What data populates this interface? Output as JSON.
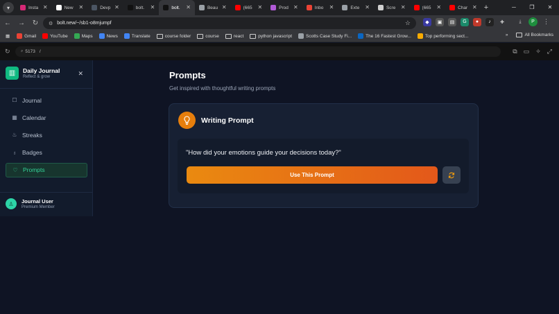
{
  "browser": {
    "tabs": [
      {
        "title": "Insta",
        "icon": "instagram-icon",
        "color": "#d62976",
        "active": false
      },
      {
        "title": "New",
        "icon": "new-tab-icon",
        "color": "#ffffff",
        "active": false
      },
      {
        "title": "Devp",
        "icon": "d-icon",
        "color": "#4b5563",
        "active": false
      },
      {
        "title": "bolt.",
        "icon": "bolt-icon",
        "color": "#111111",
        "active": false
      },
      {
        "title": "bolt.",
        "icon": "bolt-icon",
        "color": "#111111",
        "active": true
      },
      {
        "title": "Beau",
        "icon": "globe-icon",
        "color": "#9aa0a6",
        "active": false
      },
      {
        "title": "(665",
        "icon": "youtube-icon",
        "color": "#ff0000",
        "active": false
      },
      {
        "title": "Prod",
        "icon": "product-icon",
        "color": "#b05ad6",
        "active": false
      },
      {
        "title": "Inbo",
        "icon": "gmail-icon",
        "color": "#ea4335",
        "active": false
      },
      {
        "title": "Exte",
        "icon": "puzzle-icon",
        "color": "#9aa0a6",
        "active": false
      },
      {
        "title": "Scre",
        "icon": "image-icon",
        "color": "#cfcfcf",
        "active": false
      },
      {
        "title": "(665",
        "icon": "youtube-icon",
        "color": "#ff0000",
        "active": false
      },
      {
        "title": "Char",
        "icon": "youtube-icon",
        "color": "#ff0000",
        "active": false
      }
    ],
    "url": "bolt.new/~/sb1-o8mjumpf",
    "bookmarks": [
      {
        "label": "Gmail",
        "icon": "gmail-icon",
        "color": "#ea4335"
      },
      {
        "label": "YouTube",
        "icon": "youtube-icon",
        "color": "#ff0000"
      },
      {
        "label": "Maps",
        "icon": "maps-icon",
        "color": "#34a853"
      },
      {
        "label": "News",
        "icon": "news-icon",
        "color": "#4285f4"
      },
      {
        "label": "Translate",
        "icon": "translate-icon",
        "color": "#4285f4"
      },
      {
        "label": "course folder",
        "icon": "folder-icon",
        "color": ""
      },
      {
        "label": "course",
        "icon": "folder-icon",
        "color": ""
      },
      {
        "label": "react",
        "icon": "folder-icon",
        "color": ""
      },
      {
        "label": "python javascript",
        "icon": "folder-icon",
        "color": ""
      },
      {
        "label": "Scotts Case Study Fi...",
        "icon": "globe-icon",
        "color": "#9aa0a6"
      },
      {
        "label": "The 16 Fastest Grow...",
        "icon": "linkedin-icon",
        "color": "#0a66c2"
      },
      {
        "label": "Top performing sect...",
        "icon": "grow-icon",
        "color": "#f9ab00"
      }
    ],
    "all_bookmarks": "All Bookmarks",
    "profile_initial": "P"
  },
  "preview": {
    "port": "5173",
    "path": "/"
  },
  "sidebar": {
    "brand_title": "Daily Journal",
    "brand_subtitle": "Reflect & grow",
    "items": [
      {
        "label": "Journal",
        "icon": "chat-icon",
        "active": false
      },
      {
        "label": "Calendar",
        "icon": "calendar-icon",
        "active": false
      },
      {
        "label": "Streaks",
        "icon": "flame-icon",
        "active": false
      },
      {
        "label": "Badges",
        "icon": "award-icon",
        "active": false
      },
      {
        "label": "Prompts",
        "icon": "lightbulb-icon",
        "active": true
      }
    ],
    "user_name": "Journal User",
    "user_role": "Premium Member"
  },
  "main": {
    "title": "Prompts",
    "subtitle": "Get inspired with thoughtful writing prompts",
    "card_title": "Writing Prompt",
    "prompt": "\"How did your emotions guide your decisions today?\"",
    "use_button": "Use This Prompt"
  },
  "colors": {
    "accent_green": "#34d399",
    "accent_orange": "#ea8a10",
    "background": "#0f1424"
  }
}
